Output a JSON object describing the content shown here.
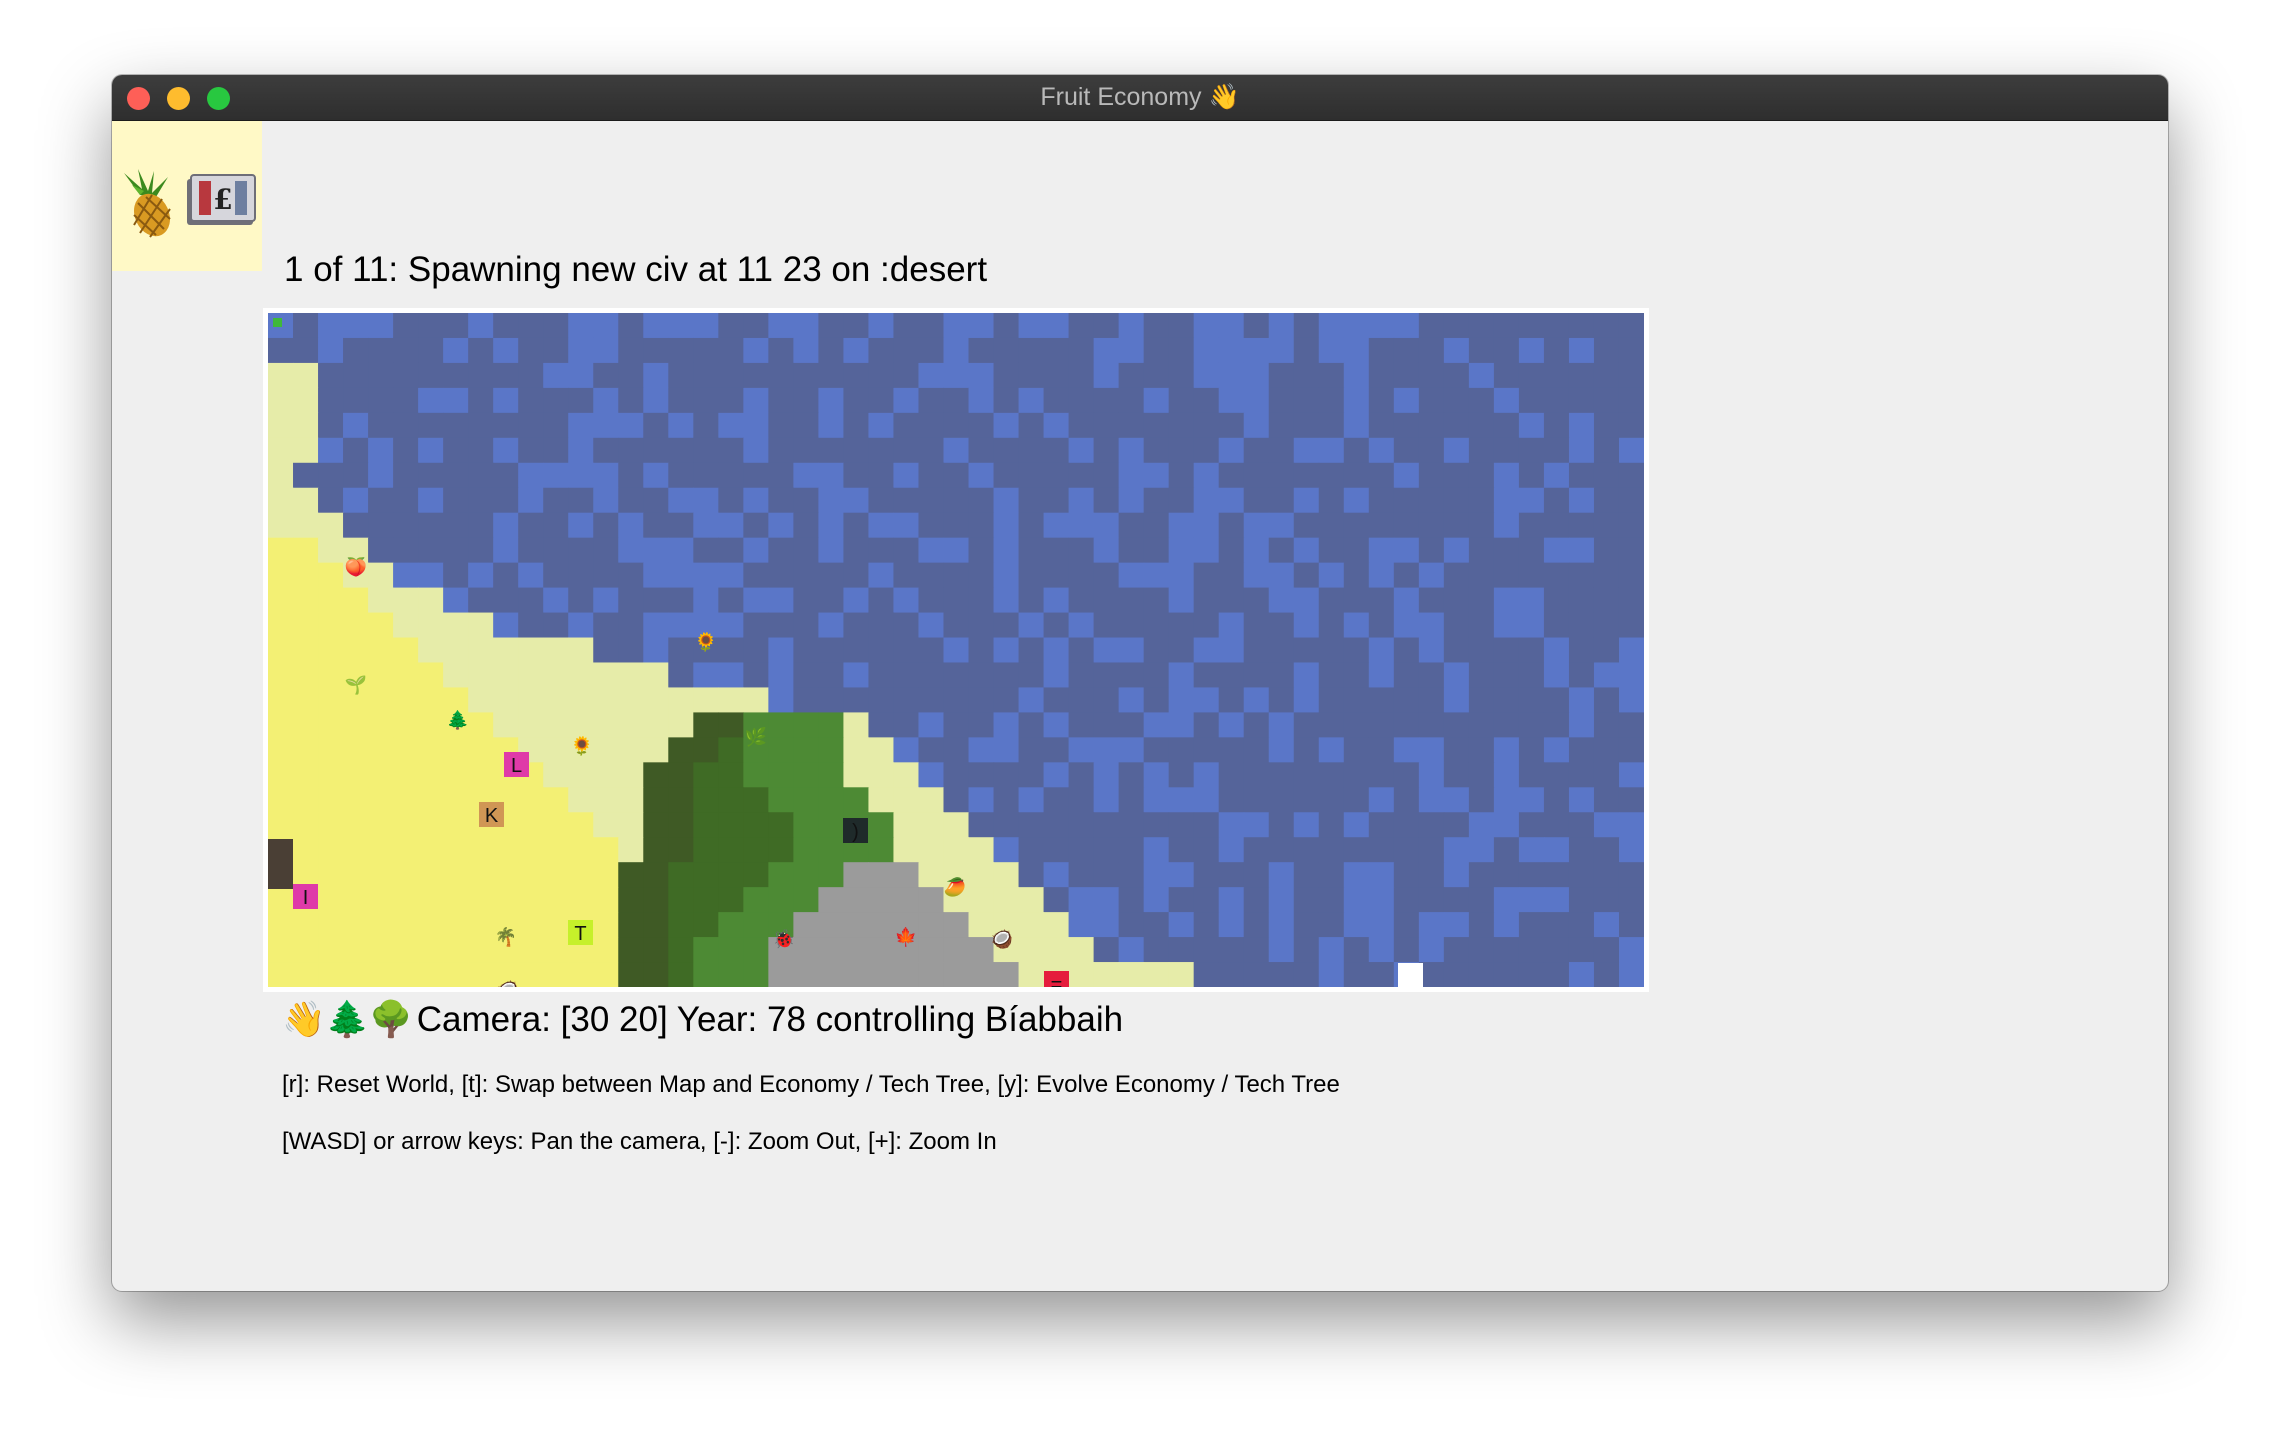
{
  "window": {
    "title": "Fruit Economy 👋"
  },
  "toolbar": {
    "icons": [
      "pineapple-icon",
      "pound-banknote-icon"
    ]
  },
  "status": {
    "text": "1 of 11: Spawning new civ at 11 23 on :desert"
  },
  "camera": {
    "emoji": "👋🌲🌳",
    "text": "Camera: [30 20] Year: 78 controlling Bíabbaih"
  },
  "help": {
    "line1": "[r]: Reset World, [t]: Swap between Map and Economy / Tech Tree, [y]: Evolve Economy / Tech Tree",
    "line2": "[WASD] or arrow keys: Pan the camera, [-]: Zoom Out, [+]: Zoom In"
  },
  "colors": {
    "ocean_dark": "#55649a",
    "ocean_light": "#5a76c8",
    "beach": "#e6eca9",
    "desert": "#f3f074",
    "forest_dark": "#3f5a25",
    "forest_mid": "#3f6b25",
    "forest_light": "#4d8a34",
    "rock": "#9b9b9b",
    "label_magenta": "#df3aa8",
    "label_tan": "#d09655",
    "label_lime": "#c6f02a",
    "label_red": "#e51d3c"
  },
  "map": {
    "civ_labels": [
      {
        "letter": "L",
        "color": "#df3aa8"
      },
      {
        "letter": "K",
        "color": "#d09655"
      },
      {
        "letter": "I",
        "color": "#df3aa8"
      },
      {
        "letter": "T",
        "color": "#c6f02a"
      },
      {
        "letter": "=",
        "color": "#e51d3c"
      },
      {
        "letter": ")",
        "color": "#1f2a2a"
      }
    ],
    "features": [
      "peach",
      "sunflower",
      "tree-seedling",
      "evergreen-tree",
      "sunflower",
      "herb",
      "palm-tree",
      "coconut",
      "mango",
      "coconut",
      "maple-leaf",
      "bug"
    ]
  }
}
